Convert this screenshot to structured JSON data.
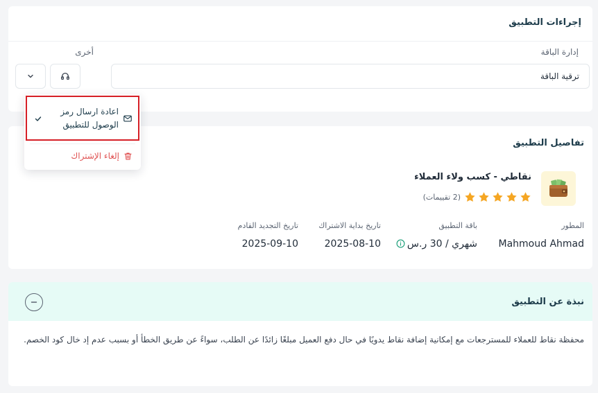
{
  "actions": {
    "title": "إجراءات التطبيق",
    "manage_label": "إدارة الباقة",
    "other_label": "أخرى",
    "plan_select_value": "ترقية الباقة",
    "menu": {
      "resend_label": "اعادة ارسال رمز الوصول للتطبيق",
      "cancel_label": "إلغاء الإشتراك"
    }
  },
  "details": {
    "title": "تفاصيل التطبيق",
    "app_name": "نقاطي - كسب ولاء العملاء",
    "rating_stars": 5,
    "rating_count": "(2 تقييمات)",
    "developer_label": "المطور",
    "developer_value": "Mahmoud Ahmad",
    "plan_label": "باقة التطبيق",
    "plan_value": "شهري / 30 ر.س",
    "start_label": "تاريخ بداية الاشتراك",
    "start_value": "2025-08-10",
    "renewal_label": "تاريخ التجديد القادم",
    "renewal_value": "2025-09-10"
  },
  "about": {
    "title": "نبذة عن التطبيق",
    "body": "محفظة نقاط للعملاء للمسترجعات مع إمكانية إضافة نقاط يدويًا في حال دفع العميل مبلغًا زائدًا عن الطلب، سواءً عن طريق الخطأ أو بسبب عدم إد خال كود الخصم."
  },
  "colors": {
    "accent_teal_bg": "#e6fbf6",
    "danger": "#e05252",
    "star": "#f5a623",
    "highlight_border": "#d61f26"
  }
}
